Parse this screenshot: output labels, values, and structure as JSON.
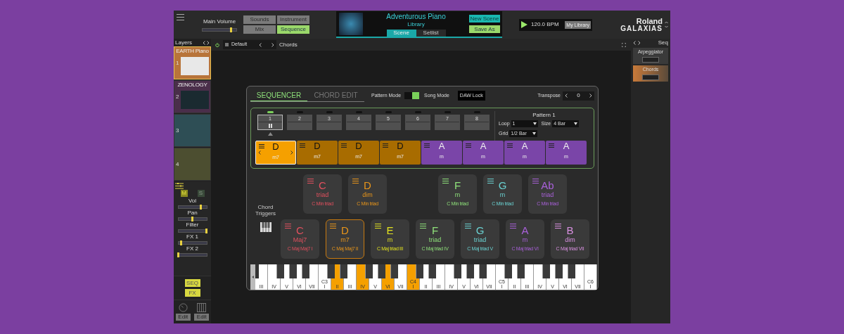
{
  "top_bar": {
    "main_volume": {
      "label": "Main Volume",
      "level": 0.85
    },
    "view_buttons": [
      {
        "label": "Sounds",
        "selected": false
      },
      {
        "label": "Instrument",
        "selected": false
      },
      {
        "label": "Mix",
        "selected": false
      },
      {
        "label": "Sequence",
        "selected": true
      }
    ],
    "scene": {
      "title": "Adventurous Piano",
      "subtitle": "Library",
      "tabs": [
        {
          "label": "Scene",
          "selected": true
        },
        {
          "label": "Setlist",
          "selected": false
        }
      ],
      "buttons": [
        "New Scene",
        "Save As"
      ]
    },
    "transport": {
      "tempo": "120.0 BPM",
      "library_button": "My Library"
    },
    "brand": {
      "line_1": "Roland",
      "line_2": "GALAXIAS"
    }
  },
  "layers_panel": {
    "title": "Layers",
    "layers": [
      {
        "number": "1",
        "name": "EARTH Piano",
        "selected": true,
        "color": "#b8743a"
      },
      {
        "number": "2",
        "name": "ZENOLOGY",
        "selected": false,
        "color": "#4a2e4a"
      },
      {
        "number": "3",
        "selected": false,
        "color": "#2e4e55"
      },
      {
        "number": "4",
        "selected": false,
        "color": "#4c4e30"
      }
    ]
  },
  "mixer": {
    "mute": {
      "label": "M",
      "on": true
    },
    "solo": {
      "label": "S",
      "on": false
    },
    "sliders": [
      {
        "label": "Vol",
        "level": 0.8
      },
      {
        "label": "Pan",
        "level": 0.5
      },
      {
        "label": "Filter",
        "level": 1.0
      },
      {
        "label": "FX 1",
        "level": 0.1
      },
      {
        "label": "FX 2",
        "level": 0.0
      }
    ],
    "buttons": [
      {
        "label": "SEQ",
        "on": true
      },
      {
        "label": "FX",
        "on": true
      }
    ],
    "edit_buttons": [
      "Edit",
      "Edit"
    ]
  },
  "toolbar": {
    "preset": "Default",
    "title": "Chords"
  },
  "seq_panel": {
    "title": "Seq",
    "items": [
      {
        "name": "Arpeggiator",
        "selected": false
      },
      {
        "name": "Chords",
        "selected": true
      }
    ]
  },
  "sequencer": {
    "tabs": [
      {
        "label": "SEQUENCER",
        "selected": true
      },
      {
        "label": "CHORD EDIT",
        "selected": false
      }
    ],
    "pattern_mode_label": "Pattern Mode",
    "mode_toggle": {
      "on": true
    },
    "song_mode_label": "Song Mode",
    "daw_lock": "DAW Lock",
    "transpose": {
      "label": "Transpose",
      "value": "0"
    },
    "patterns": [
      {
        "number": "1",
        "selected": true,
        "active": true
      },
      {
        "number": "2",
        "selected": false,
        "active": false
      },
      {
        "number": "3",
        "selected": false,
        "active": false
      },
      {
        "number": "4",
        "selected": false,
        "active": false
      },
      {
        "number": "5",
        "selected": false,
        "active": false
      },
      {
        "number": "6",
        "selected": false,
        "active": false
      },
      {
        "number": "7",
        "selected": false,
        "active": false
      },
      {
        "number": "8",
        "selected": false,
        "active": false
      }
    ],
    "pattern_settings": {
      "title": "Pattern 1",
      "loop": {
        "label": "Loop",
        "value": "1"
      },
      "size": {
        "label": "Size",
        "value": "4 Bar"
      },
      "grid": {
        "label": "Grid",
        "value": "1/2 Bar"
      }
    },
    "steps": [
      {
        "root": "D",
        "quality": "m7",
        "selected": true,
        "color": "#f5a000"
      },
      {
        "root": "D",
        "quality": "m7",
        "selected": false,
        "color": "#a86c00"
      },
      {
        "root": "D",
        "quality": "m7",
        "selected": false,
        "color": "#a86c00"
      },
      {
        "root": "D",
        "quality": "m7",
        "selected": false,
        "color": "#a86c00"
      },
      {
        "root": "A",
        "quality": "m",
        "selected": false,
        "color": "#7a45a8"
      },
      {
        "root": "A",
        "quality": "m",
        "selected": false,
        "color": "#7a45a8"
      },
      {
        "root": "A",
        "quality": "m",
        "selected": false,
        "color": "#7a45a8"
      },
      {
        "root": "A",
        "quality": "m",
        "selected": false,
        "color": "#7a45a8"
      }
    ]
  },
  "chord_triggers": {
    "label": "Chord Triggers",
    "top_row": [
      {
        "kind": "chord",
        "root": "C",
        "quality": "triad",
        "caption": "C Min triad",
        "color": "#e0505e",
        "selected": false
      },
      {
        "kind": "chord",
        "root": "D",
        "quality": "dim",
        "caption": "C Min triad",
        "color": "#e8951a",
        "selected": false
      },
      {
        "kind": "empty"
      },
      {
        "kind": "chord",
        "root": "F",
        "quality": "m",
        "caption": "C Min triad",
        "color": "#8ee07a",
        "selected": false
      },
      {
        "kind": "chord",
        "root": "G",
        "quality": "m",
        "caption": "C Min triad",
        "color": "#6ad0d0",
        "selected": false
      },
      {
        "kind": "chord",
        "root": "Ab",
        "quality": "triad",
        "caption": "C Min triad",
        "color": "#a860d8",
        "selected": false
      }
    ],
    "bottom_row": [
      {
        "kind": "chord",
        "root": "C",
        "quality": "Maj7",
        "caption": "C Maj Maj7 I",
        "color": "#e0505e",
        "selected": false
      },
      {
        "kind": "chord",
        "root": "D",
        "quality": "m7",
        "caption": "C Maj Maj7 II",
        "color": "#e8951a",
        "selected": true
      },
      {
        "kind": "chord",
        "root": "E",
        "quality": "m",
        "caption": "C Maj triad III",
        "color": "#e0e020",
        "selected": false
      },
      {
        "kind": "chord",
        "root": "F",
        "quality": "triad",
        "caption": "C Maj triad IV",
        "color": "#8ee07a",
        "selected": false
      },
      {
        "kind": "chord",
        "root": "G",
        "quality": "triad",
        "caption": "C Maj triad V",
        "color": "#6ad0d0",
        "selected": false
      },
      {
        "kind": "chord",
        "root": "A",
        "quality": "m",
        "caption": "C Maj triad VI",
        "color": "#a860d8",
        "selected": false
      },
      {
        "kind": "chord",
        "root": "B",
        "quality": "dim",
        "caption": "C Maj triad VII",
        "color": "#d890e0",
        "selected": false
      }
    ]
  },
  "keyboard": {
    "keys": [
      {
        "label": "III",
        "pressed": false
      },
      {
        "label": "IV",
        "pressed": false
      },
      {
        "label": "V",
        "pressed": false
      },
      {
        "label": "VI",
        "pressed": false
      },
      {
        "label": "VII",
        "pressed": false
      },
      {
        "octave": "C3",
        "label": "I",
        "pressed": false
      },
      {
        "label": "II",
        "pressed": true
      },
      {
        "label": "III",
        "pressed": false
      },
      {
        "label": "IV",
        "pressed": true
      },
      {
        "label": "V",
        "pressed": false
      },
      {
        "label": "VI",
        "pressed": true
      },
      {
        "label": "VII",
        "pressed": false
      },
      {
        "octave": "C4",
        "label": "I",
        "pressed": true
      },
      {
        "label": "II",
        "pressed": false
      },
      {
        "label": "III",
        "pressed": false
      },
      {
        "label": "IV",
        "pressed": false
      },
      {
        "label": "V",
        "pressed": false
      },
      {
        "label": "VI",
        "pressed": false
      },
      {
        "label": "VII",
        "pressed": false
      },
      {
        "octave": "C5",
        "label": "I",
        "pressed": false
      },
      {
        "label": "II",
        "pressed": false
      },
      {
        "label": "III",
        "pressed": false
      },
      {
        "label": "IV",
        "pressed": false
      },
      {
        "label": "V",
        "pressed": false
      },
      {
        "label": "VI",
        "pressed": false
      },
      {
        "label": "VII",
        "pressed": false
      },
      {
        "octave": "C6",
        "label": "I",
        "pressed": false
      }
    ]
  }
}
